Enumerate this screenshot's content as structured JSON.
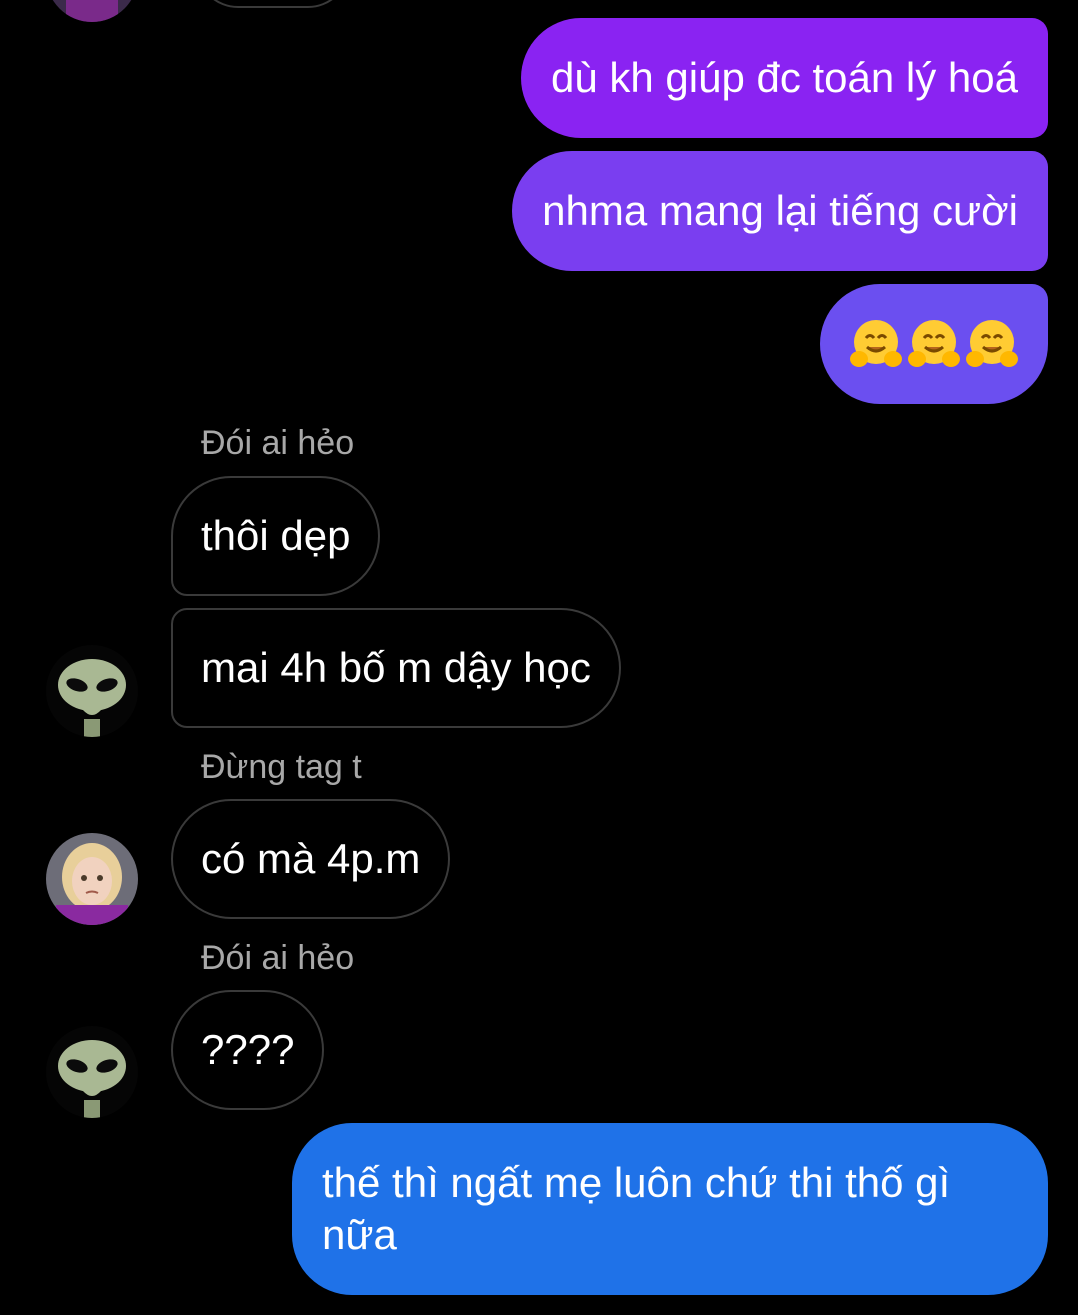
{
  "messages": {
    "out1": "dù kh giúp đc toán lý hoá",
    "out2": "nhma mang lại tiếng cười",
    "out3_emoji": [
      "hugging-face",
      "hugging-face",
      "hugging-face"
    ],
    "sender1": "Đói ai hẻo",
    "in1": "thôi dẹp",
    "in2": "mai 4h bố m dậy học",
    "sender2": "Đừng tag t",
    "in3": "có mà 4p.m",
    "sender3": "Đói ai hẻo",
    "in4": "????",
    "out4": "thế thì ngất mẹ luôn chứ thi thố gì nữa"
  },
  "colors": {
    "background": "#000000",
    "bubble_purple_top": "#8a23f2",
    "bubble_purple_mid": "#7a3ef0",
    "bubble_purple_low": "#6b4ff0",
    "bubble_blue": "#1f72e8",
    "incoming_border": "#3a3a3a",
    "sender_text": "#a8a8a8"
  }
}
